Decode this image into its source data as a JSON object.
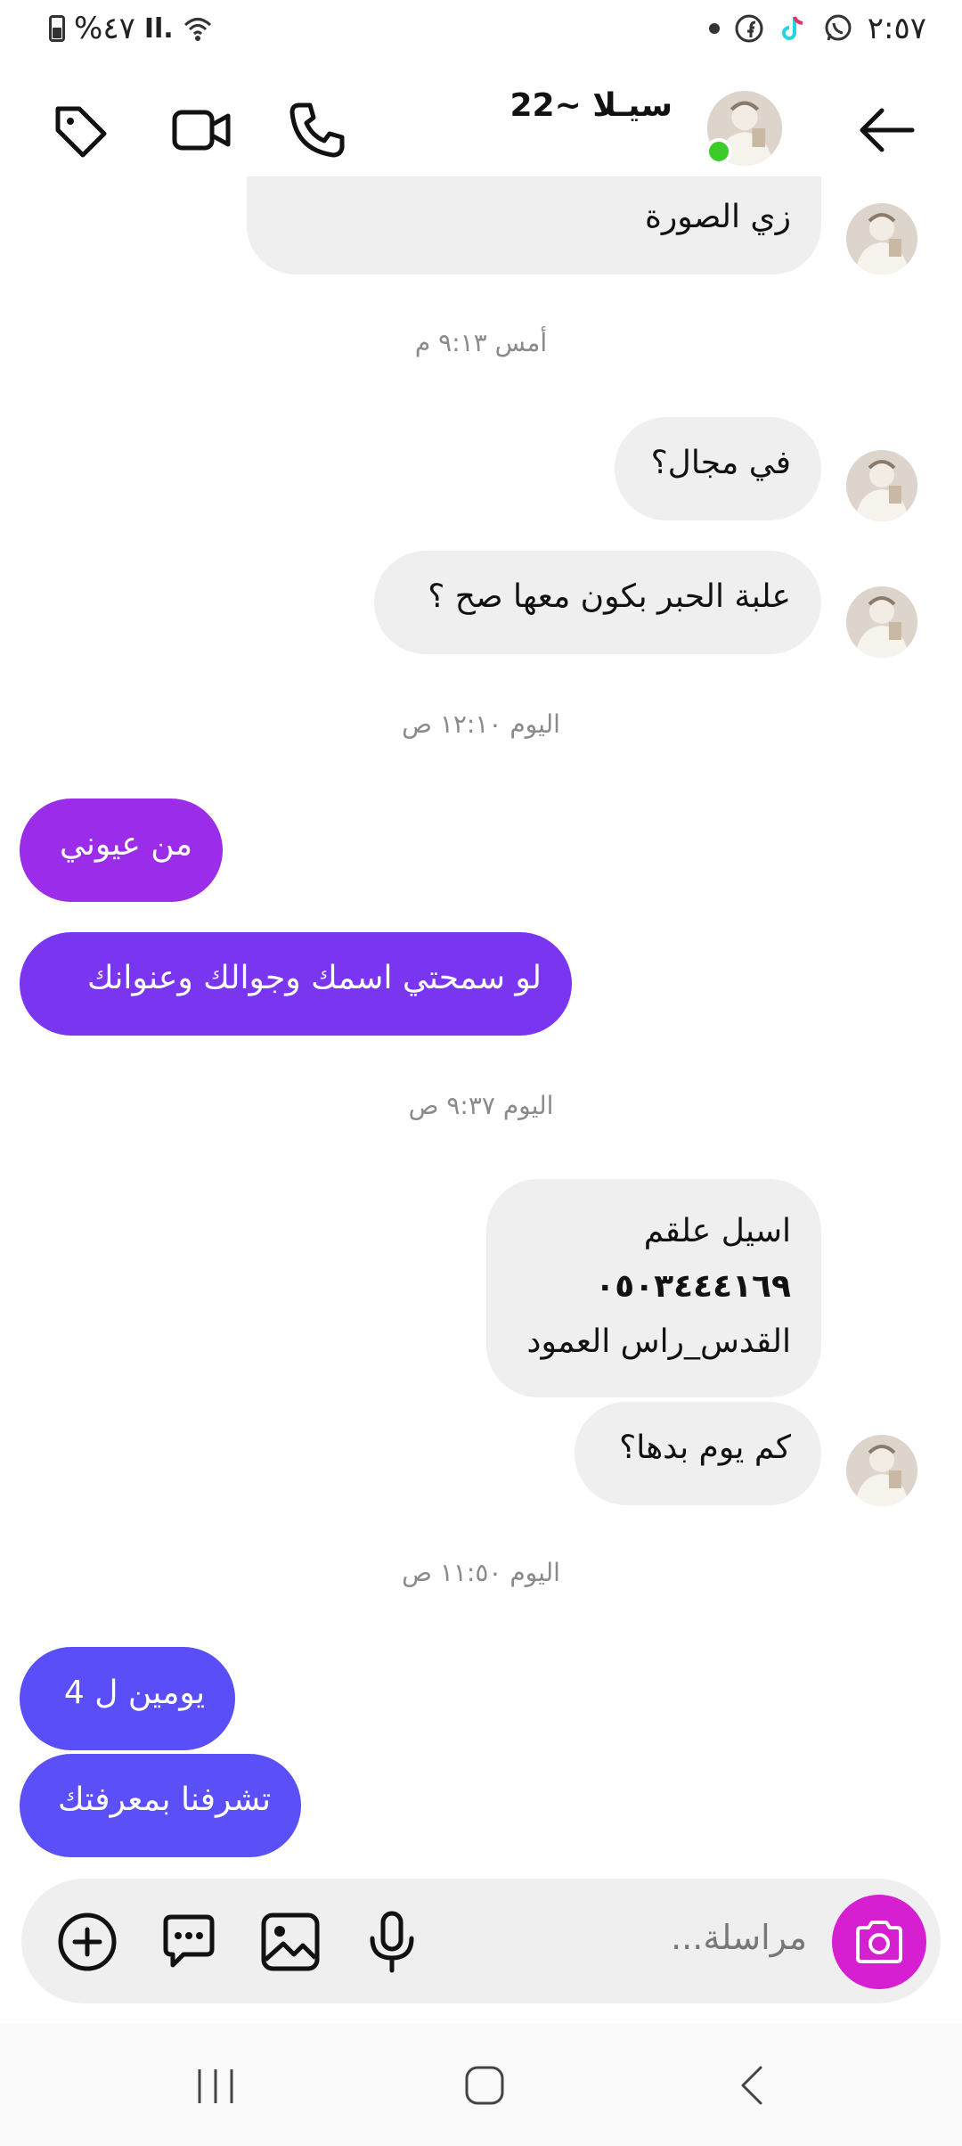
{
  "status_bar": {
    "time": "٢:٥٧",
    "battery": "%٤٧",
    "signal_text": "Il.",
    "icons": [
      "whatsapp-icon",
      "tiktok-icon",
      "facebook-icon",
      "notification-dot-icon",
      "wifi-icon",
      "signal-icon",
      "battery-icon"
    ]
  },
  "header": {
    "contact_name": "سيـلا ~22",
    "icons": [
      "back-arrow-icon",
      "phone-icon",
      "video-call-icon",
      "tag-icon"
    ],
    "online": true
  },
  "messages": [
    {
      "dir": "received",
      "text": "زي الصورة"
    },
    {
      "type": "timestamp",
      "text": "أمس ٩:١٣ م"
    },
    {
      "dir": "received",
      "text": "في مجال؟"
    },
    {
      "dir": "received",
      "text": "علبة الحبر بكون معها صح ؟"
    },
    {
      "type": "timestamp",
      "text": "اليوم ١٢:١٠ ص"
    },
    {
      "dir": "sent",
      "text": "من عيوني"
    },
    {
      "dir": "sent",
      "text": "لو سمحتي اسمك وجوالك وعنوانك"
    },
    {
      "type": "timestamp",
      "text": "اليوم ٩:٣٧ ص"
    },
    {
      "dir": "received",
      "lines": [
        "اسيل علقم",
        "٠٥٠٣٤٤٤١٦٩",
        "القدس_راس العمود"
      ]
    },
    {
      "dir": "received",
      "text": "كم يوم بدها؟"
    },
    {
      "type": "timestamp",
      "text": "اليوم ١١:٥٠ ص"
    },
    {
      "dir": "sent",
      "text": "يومين ل 4"
    },
    {
      "dir": "sent",
      "text": "تشرفنا بمعرفتك"
    }
  ],
  "composer": {
    "placeholder": "مراسلة...",
    "icons": [
      "add-icon",
      "chat-sticker-icon",
      "gallery-icon",
      "microphone-icon",
      "camera-icon"
    ]
  },
  "colors": {
    "sent_1": "#9a2cea",
    "sent_2": "#7a35f0",
    "sent_3": "#5a4ef8",
    "sent_4": "#5b4ff7",
    "camera": "#d51fd0",
    "online": "#3ccc2a",
    "received_bg": "#efefef"
  },
  "navbar": {
    "icons": [
      "recent-apps-icon",
      "home-icon",
      "back-icon"
    ]
  }
}
